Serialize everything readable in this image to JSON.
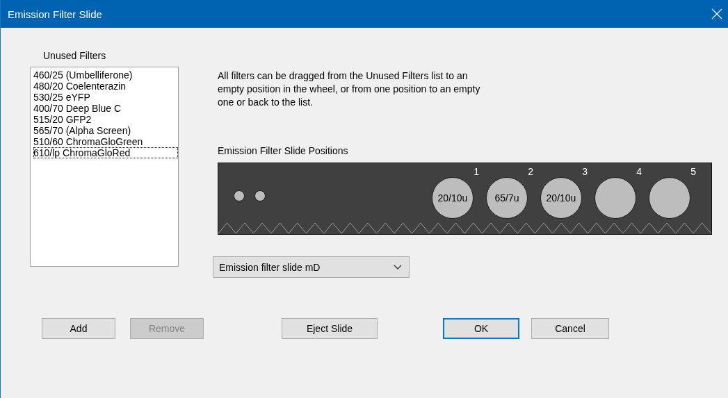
{
  "window": {
    "title": "Emission Filter Slide"
  },
  "unused_filters": {
    "label": "Unused Filters",
    "items": [
      {
        "text": "460/25 (Umbelliferone)",
        "focused": false
      },
      {
        "text": "480/20 Coelenterazin",
        "focused": false
      },
      {
        "text": "530/25 eYFP",
        "focused": false
      },
      {
        "text": "400/70 Deep Blue C",
        "focused": false
      },
      {
        "text": "515/20 GFP2",
        "focused": false
      },
      {
        "text": "565/70 (Alpha Screen)",
        "focused": false
      },
      {
        "text": "510/60 ChromaGloGreen",
        "focused": false
      },
      {
        "text": "610/lp ChromaGloRed",
        "focused": true
      }
    ]
  },
  "instructions": "All filters can be dragged from the Unused Filters list to an empty position in the wheel, or from one position to an empty one or back to the list.",
  "slide": {
    "label": "Emission Filter Slide Positions",
    "positions": [
      {
        "number": "1",
        "filter": "20/10u"
      },
      {
        "number": "2",
        "filter": "65/7u"
      },
      {
        "number": "3",
        "filter": "20/10u"
      },
      {
        "number": "4"
      },
      {
        "number": "5"
      }
    ]
  },
  "slide_select": {
    "value": "Emission filter slide mD"
  },
  "buttons": [
    {
      "label": "Add",
      "disabled": false,
      "default": false
    },
    {
      "label": "Remove",
      "disabled": true,
      "default": false
    },
    {
      "label": "Eject Slide",
      "disabled": false,
      "default": false
    },
    {
      "label": "OK",
      "disabled": false,
      "default": true
    },
    {
      "label": "Cancel",
      "disabled": false,
      "default": false
    }
  ]
}
